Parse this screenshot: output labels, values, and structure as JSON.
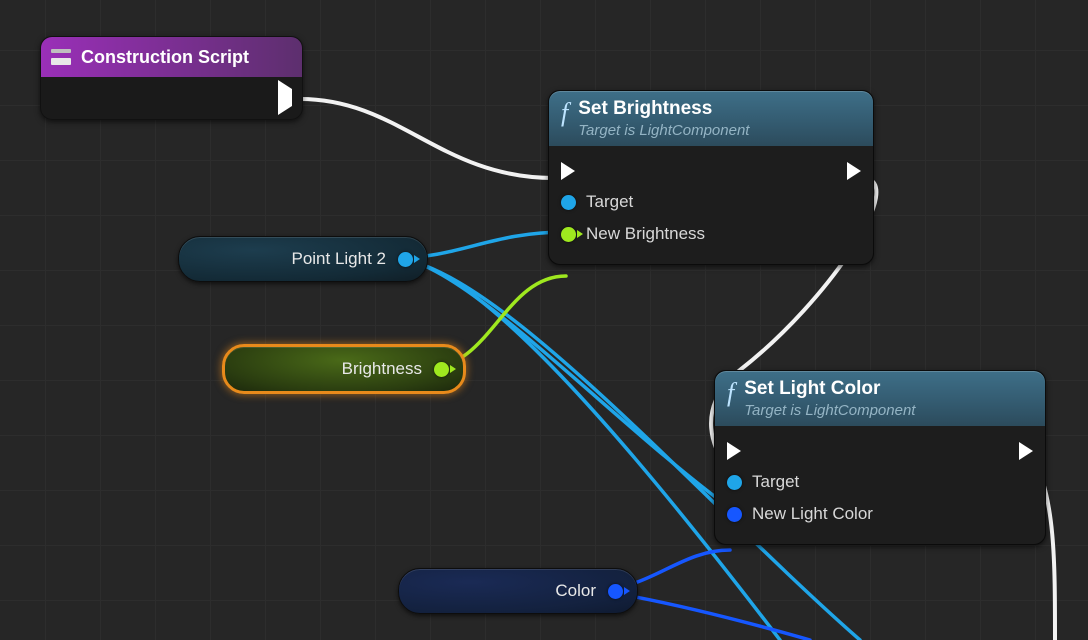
{
  "event": {
    "title": "Construction Script"
  },
  "nodes": {
    "setBrightness": {
      "title": "Set Brightness",
      "subtitle": "Target is LightComponent",
      "pins": {
        "target": "Target",
        "newBrightness": "New Brightness"
      }
    },
    "setLightColor": {
      "title": "Set Light Color",
      "subtitle": "Target is LightComponent",
      "pins": {
        "target": "Target",
        "newLightColor": "New Light Color"
      }
    }
  },
  "vars": {
    "pointLight2": "Point Light 2",
    "brightness": "Brightness",
    "color": "Color"
  },
  "colors": {
    "execWire": "#f2f2f2",
    "objectWire": "#1fa5e8",
    "floatWire": "#9fe81f",
    "structWire": "#1657ff"
  }
}
